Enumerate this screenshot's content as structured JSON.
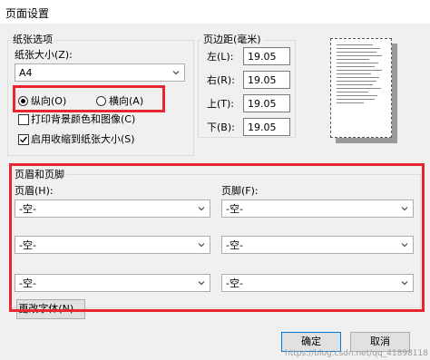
{
  "dialog": {
    "title": "页面设置"
  },
  "paper_options": {
    "group_label": "纸张选项",
    "size_label": "纸张大小(Z):",
    "size_value": "A4",
    "portrait_label": "纵向(O)",
    "landscape_label": "横向(A)",
    "portrait_selected": true,
    "print_background_label": "打印背景颜色和图像(C)",
    "print_background_checked": false,
    "shrink_to_fit_label": "启用收缩到纸张大小(S)",
    "shrink_to_fit_checked": true
  },
  "margins": {
    "group_label": "页边距(毫米)",
    "left_label": "左(L):",
    "left_value": "19.05",
    "right_label": "右(R):",
    "right_value": "19.05",
    "top_label": "上(T):",
    "top_value": "19.05",
    "bottom_label": "下(B):",
    "bottom_value": "19.05"
  },
  "header_footer": {
    "group_label": "页眉和页脚",
    "header_label": "页眉(H):",
    "footer_label": "页脚(F):",
    "header_values": [
      "-空-",
      "-空-",
      "-空-"
    ],
    "footer_values": [
      "-空-",
      "-空-",
      "-空-"
    ],
    "change_font_label": "更改字体(N)..."
  },
  "buttons": {
    "ok_label": "确定",
    "cancel_label": "取消"
  },
  "watermark": "https://blog.csdn.net/qq_41898118",
  "colors": {
    "highlight": "#e8262d",
    "dialog_bg": "#f0f0f0"
  }
}
